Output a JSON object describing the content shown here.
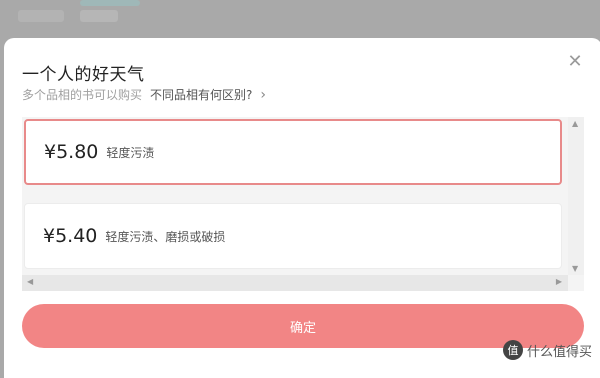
{
  "modal": {
    "title": "一个人的好天气",
    "subtitle": "多个品相的书可以购买",
    "compare_link": "不同品相有何区别?",
    "chevron": "›",
    "close_icon": "close-icon",
    "confirm_label": "确定"
  },
  "options": [
    {
      "price": "¥5.80",
      "condition": "轻度污渍",
      "selected": true
    },
    {
      "price": "¥5.40",
      "condition": "轻度污渍、磨损或破损",
      "selected": false
    }
  ],
  "watermark": {
    "logo_text": "值",
    "text": "什么值得买"
  },
  "colors": {
    "accent": "#f28585",
    "selected_border": "#e88a8a"
  }
}
